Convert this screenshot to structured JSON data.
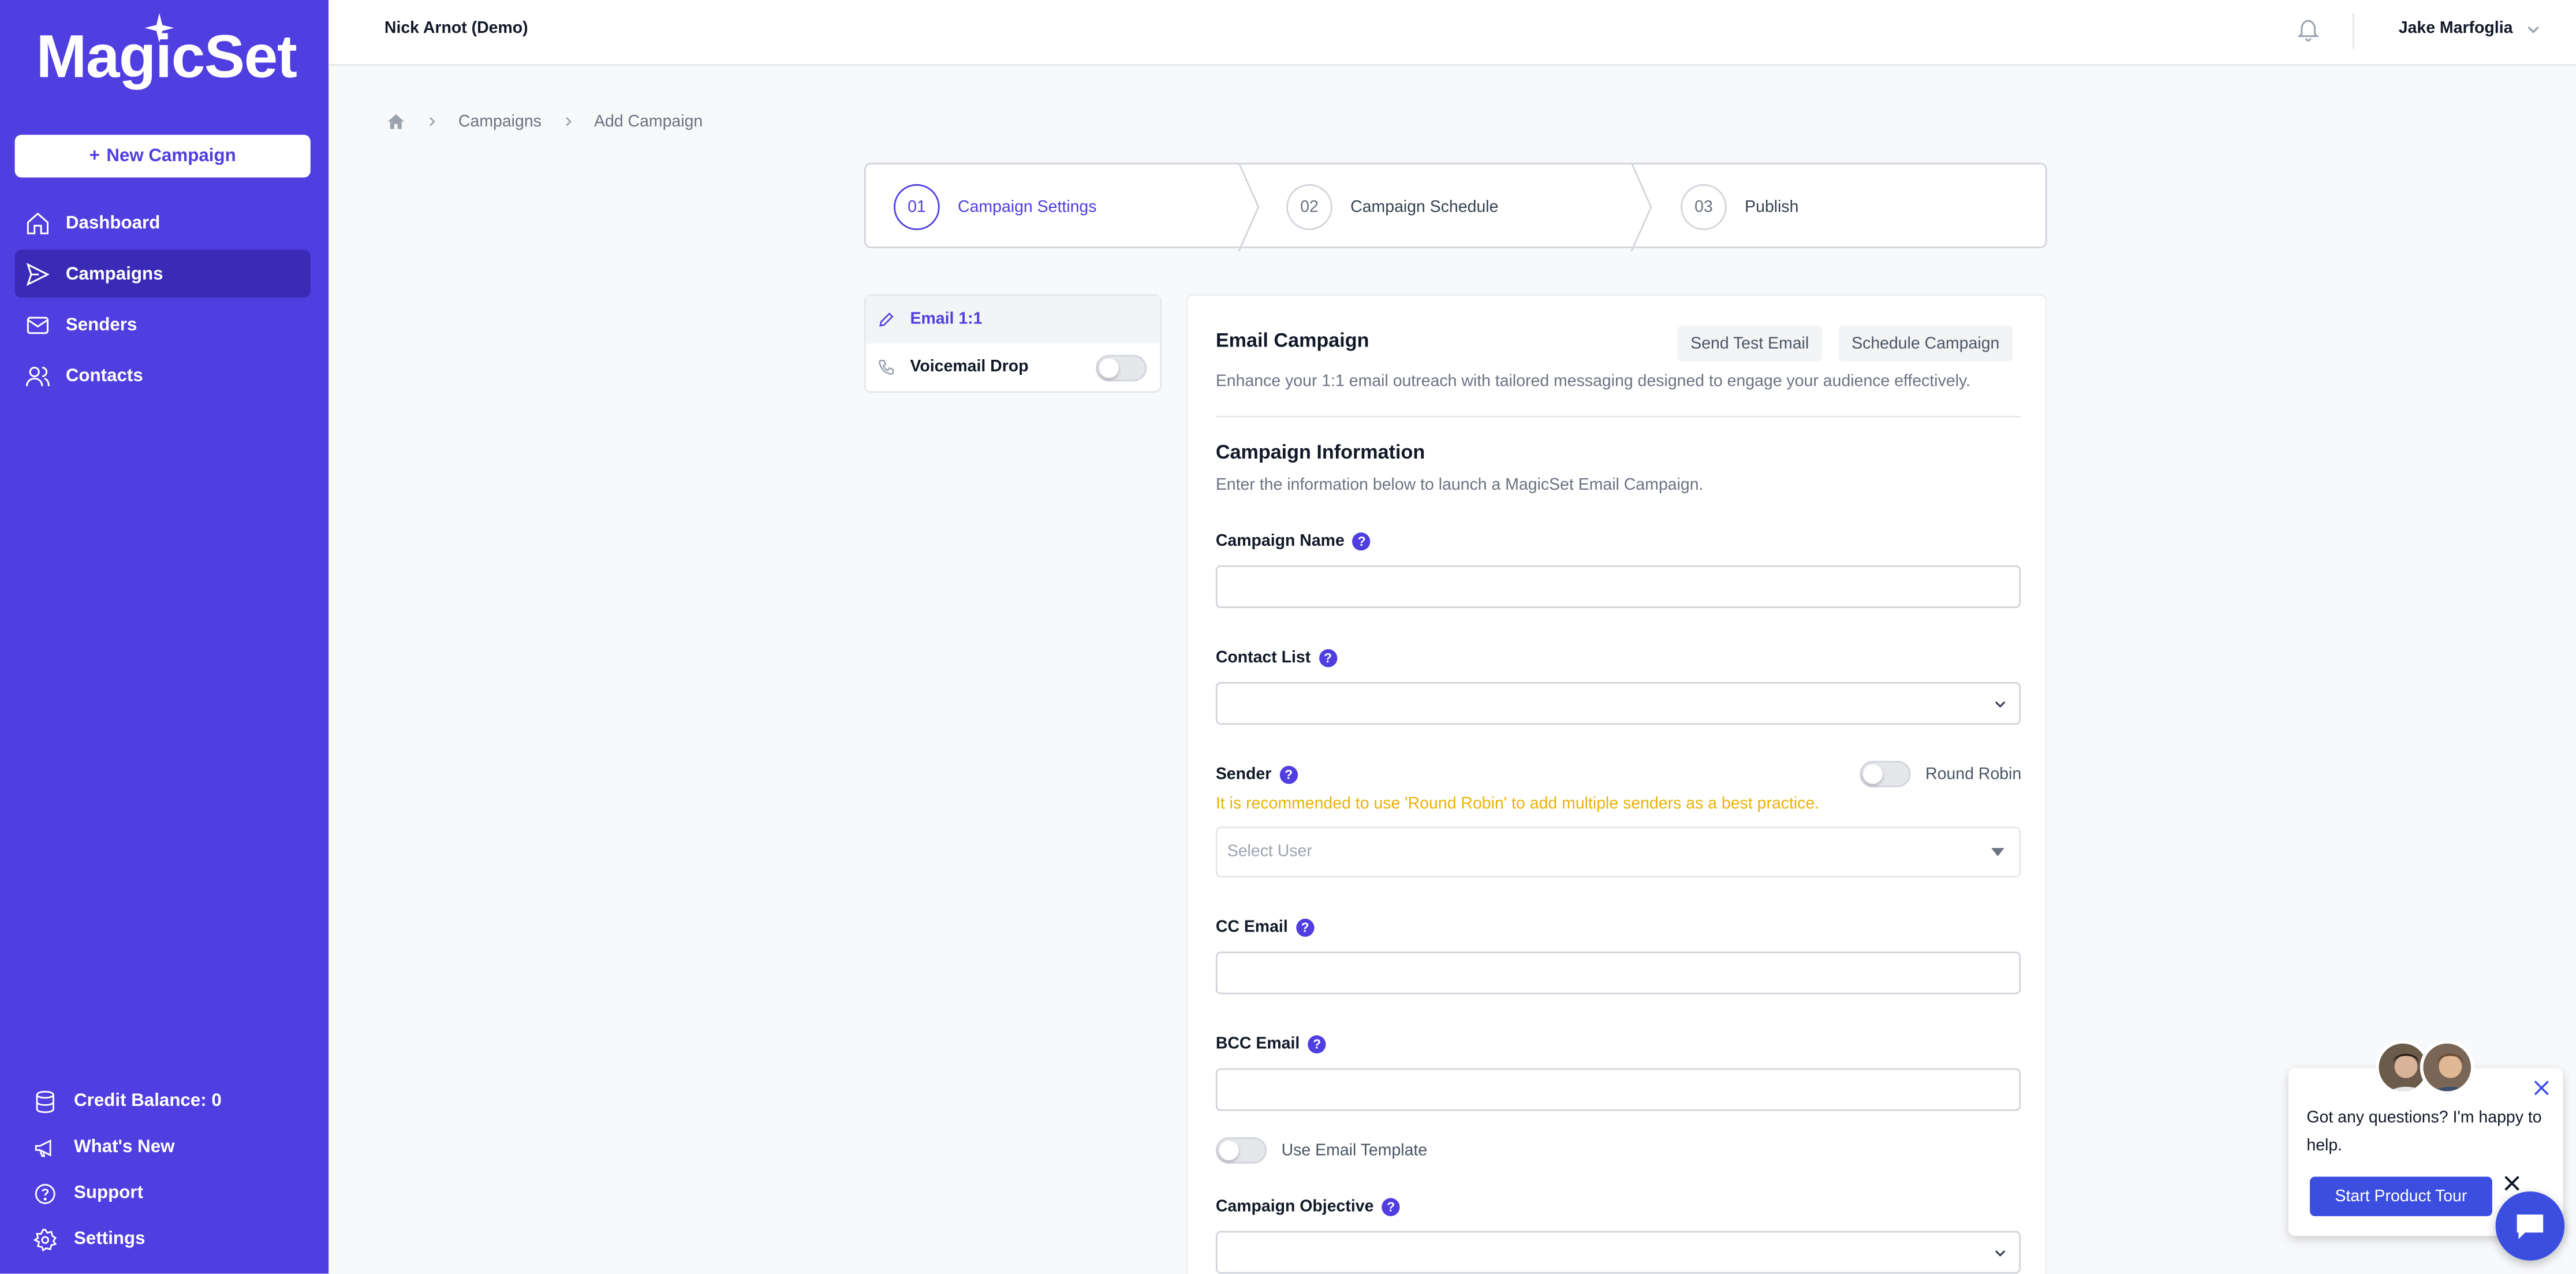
{
  "colors": {
    "brand": "#4f3ee0",
    "brand_dark": "#3a2bb6",
    "warning": "#eab308",
    "chat_blue": "#3b4ee0"
  },
  "sidebar": {
    "logo": "MagicSet",
    "new_campaign": "New Campaign",
    "items": [
      {
        "label": "Dashboard",
        "icon": "home-icon"
      },
      {
        "label": "Campaigns",
        "icon": "send-icon",
        "active": true
      },
      {
        "label": "Senders",
        "icon": "mail-icon"
      },
      {
        "label": "Contacts",
        "icon": "users-icon"
      }
    ],
    "bottom": [
      {
        "label": "Credit Balance: 0",
        "icon": "database-icon"
      },
      {
        "label": "What's New",
        "icon": "megaphone-icon"
      },
      {
        "label": "Support",
        "icon": "help-circle-icon"
      },
      {
        "label": "Settings",
        "icon": "gear-icon"
      }
    ]
  },
  "header": {
    "org": "Nick Arnot (Demo)",
    "user": "Jake Marfoglia"
  },
  "breadcrumb": {
    "items": [
      "Campaigns",
      "Add Campaign"
    ]
  },
  "steps": [
    {
      "num": "01",
      "label": "Campaign Settings",
      "active": true
    },
    {
      "num": "02",
      "label": "Campaign Schedule"
    },
    {
      "num": "03",
      "label": "Publish"
    }
  ],
  "channels": [
    {
      "label": "Email 1:1",
      "active": true
    },
    {
      "label": "Voicemail Drop",
      "enabled": false
    }
  ],
  "email_campaign": {
    "title": "Email Campaign",
    "send_test": "Send Test Email",
    "schedule": "Schedule Campaign",
    "description": "Enhance your 1:1 email outreach with tailored messaging designed to engage your audience effectively."
  },
  "campaign_info": {
    "title": "Campaign Information",
    "subtitle": "Enter the information below to launch a MagicSet Email Campaign."
  },
  "fields": {
    "campaign_name": {
      "label": "Campaign Name",
      "value": ""
    },
    "contact_list": {
      "label": "Contact List",
      "value": ""
    },
    "sender": {
      "label": "Sender",
      "round_robin": "Round Robin",
      "round_robin_enabled": false,
      "warning": "It is recommended to use 'Round Robin' to add multiple senders as a best practice.",
      "placeholder": "Select User"
    },
    "cc_email": {
      "label": "CC Email",
      "value": ""
    },
    "bcc_email": {
      "label": "BCC Email",
      "value": ""
    },
    "use_template": {
      "label": "Use Email Template",
      "enabled": false
    },
    "campaign_objective": {
      "label": "Campaign Objective",
      "value": ""
    }
  },
  "chat": {
    "message": "Got any questions? I'm happy to help.",
    "tour_button": "Start Product Tour"
  }
}
